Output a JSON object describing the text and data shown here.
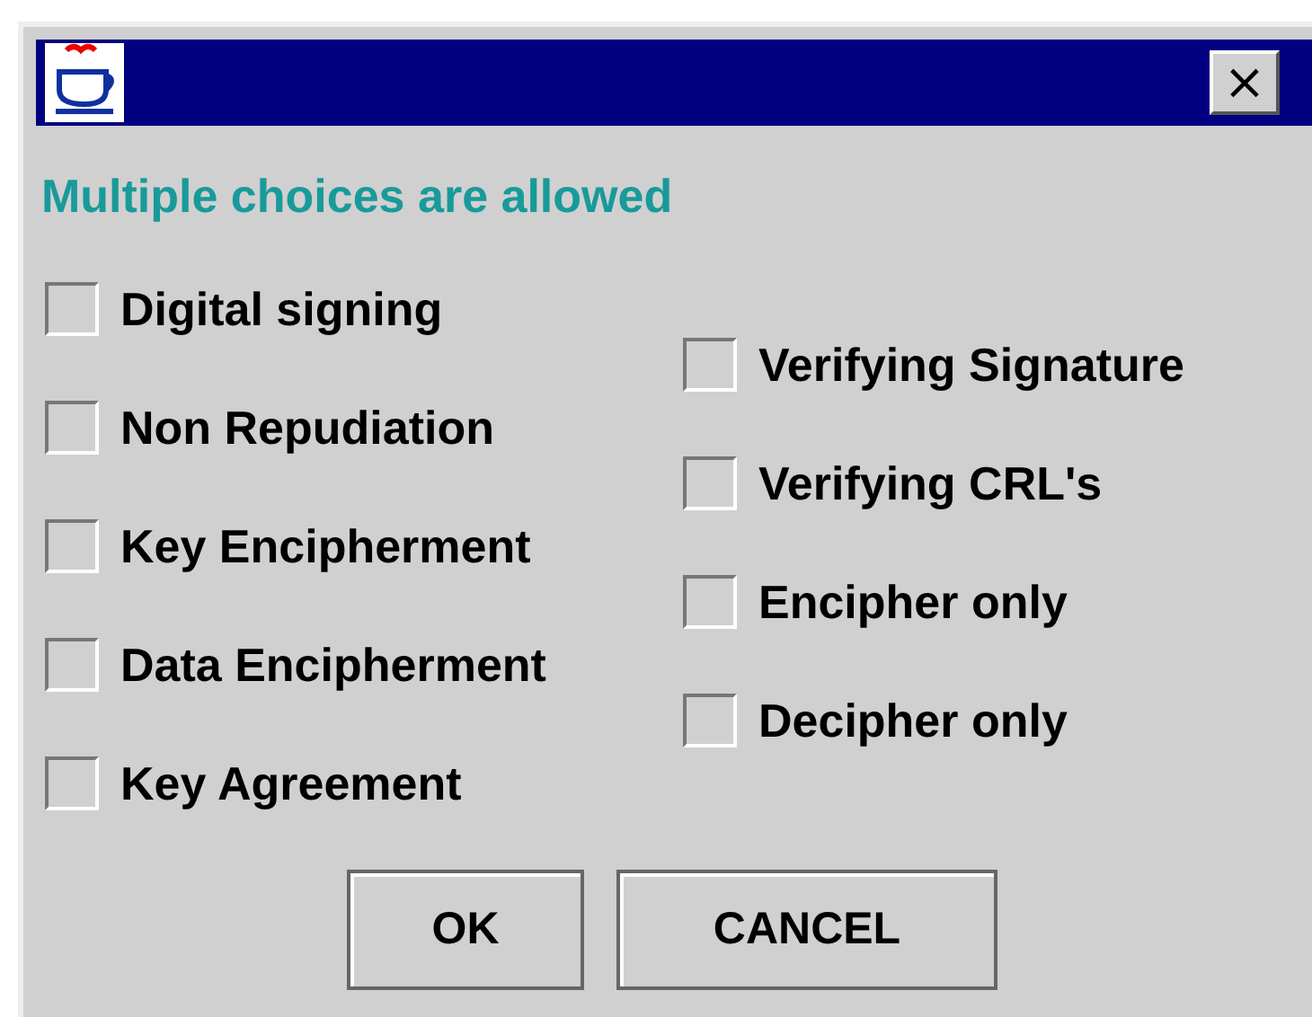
{
  "heading": "Multiple choices are allowed",
  "close_button": {
    "label": "×"
  },
  "left_options": [
    {
      "label": "Digital signing",
      "checked": false
    },
    {
      "label": "Non Repudiation",
      "checked": false
    },
    {
      "label": "Key Encipherment",
      "checked": false
    },
    {
      "label": "Data Encipherment",
      "checked": false
    },
    {
      "label": "Key Agreement",
      "checked": false
    }
  ],
  "right_options": [
    {
      "label": "Verifying Signature",
      "checked": false
    },
    {
      "label": "Verifying CRL's",
      "checked": false
    },
    {
      "label": "Encipher only",
      "checked": false
    },
    {
      "label": "Decipher only",
      "checked": false
    }
  ],
  "buttons": [
    "OK",
    "CANCEL"
  ]
}
